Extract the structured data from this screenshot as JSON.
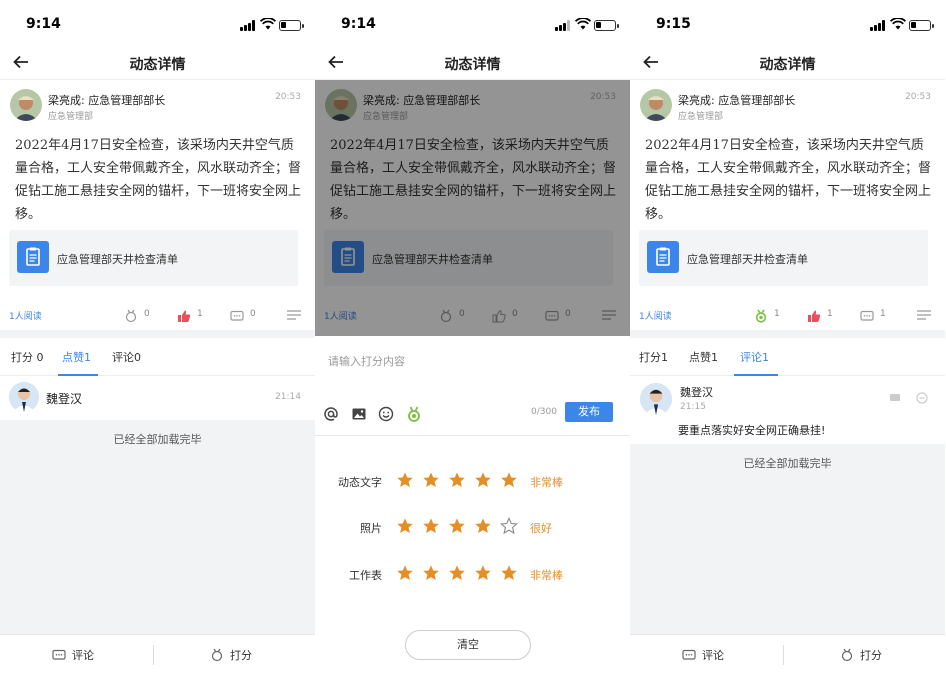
{
  "status_bar": {
    "time_1": "9:14",
    "time_2": "9:14",
    "time_3": "9:15"
  },
  "nav": {
    "title": "动态详情"
  },
  "post": {
    "author": "梁亮成: 应急管理部部长",
    "dept": "应急管理部",
    "time": "20:53",
    "text": "2022年4月17日安全检查，该采场内天井空气质量合格，工人安全带佩戴齐全，风水联动齐全；督促钻工施工悬挂安全网的锚杆，下一班将安全网上移。",
    "attachment": "应急管理部天井检查清单"
  },
  "stats": {
    "read": "1人阅读",
    "screen1": {
      "score": "0",
      "like": "1",
      "comment": "0"
    },
    "screen2": {
      "score": "0",
      "like": "0",
      "comment": "0"
    },
    "screen3": {
      "score": "1",
      "like": "1",
      "comment": "1"
    }
  },
  "tabs": {
    "screen1": [
      "打分 0",
      "点赞1",
      "评论0"
    ],
    "screen3": [
      "打分1",
      "点赞1",
      "评论1"
    ]
  },
  "like_row": {
    "name": "魏登汉",
    "time": "21:14"
  },
  "comment_row": {
    "name": "魏登汉",
    "time": "21:15",
    "text": "要重点落实好安全网正确悬挂!"
  },
  "loaded_text": "已经全部加载完毕",
  "bottom": {
    "comment": "评论",
    "score": "打分"
  },
  "score_sheet": {
    "placeholder": "请输入打分内容",
    "count": "0/300",
    "publish": "发布",
    "ratings": [
      {
        "label": "动态文字",
        "stars": 5,
        "text": "非常棒"
      },
      {
        "label": "照片",
        "stars": 4,
        "text": "很好"
      },
      {
        "label": "工作表",
        "stars": 5,
        "text": "非常棒"
      }
    ],
    "clear": "清空"
  },
  "colors": {
    "accent": "#3b86e8",
    "star": "#e58e26",
    "like": "#e8505b",
    "medal": "#7bc043"
  }
}
